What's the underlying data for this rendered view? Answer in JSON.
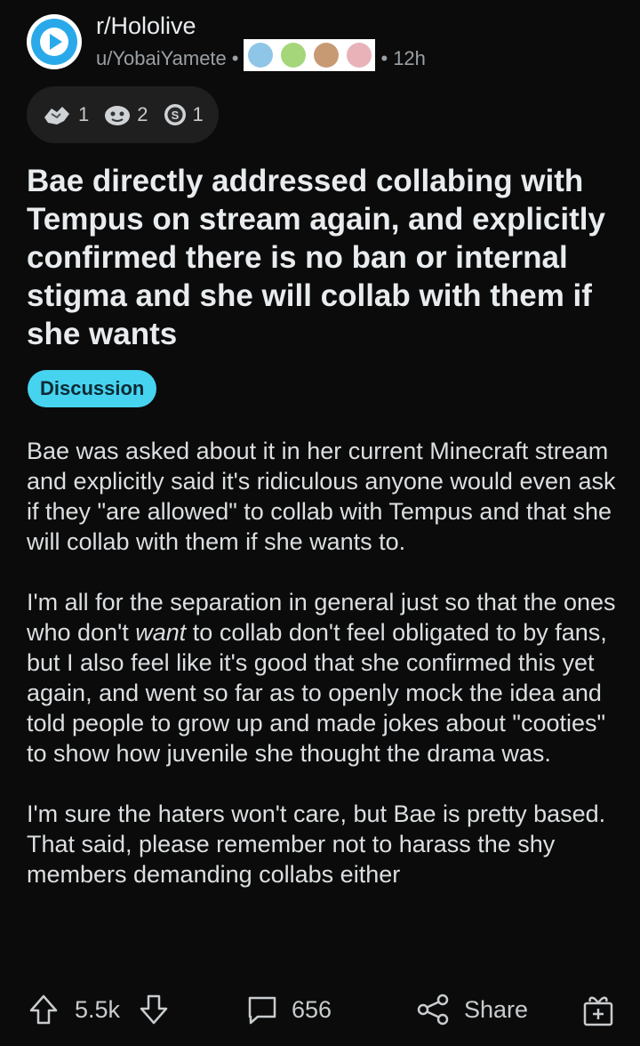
{
  "post": {
    "subreddit": "r/Hololive",
    "author": "u/YobaiYamete",
    "separator": "•",
    "age": "12h",
    "title": "Bae directly addressed collabing with Tempus on stream again, and explicitly confirmed there is no ban or internal stigma and she will collab with them if she wants",
    "flair": "Discussion",
    "awards": [
      {
        "icon": "award-handshake-icon",
        "count": "1"
      },
      {
        "icon": "award-face-icon",
        "count": "2"
      },
      {
        "icon": "award-silver-icon",
        "count": "1"
      }
    ],
    "body": {
      "p1": "Bae was asked about it in her current Minecraft stream and explicitly said it's ridiculous anyone would even ask if they \"are allowed\" to collab with Tempus and that she will collab with them if she wants to.",
      "p2_before": "I'm all for the separation in general just so that the ones who don't ",
      "p2_em": "want",
      "p2_after": " to collab don't feel obligated to by fans, but I also  feel like it's good that she confirmed this yet again, and went so far as to openly mock the idea and told people to grow up and made jokes about \"cooties\" to show how juvenile she thought the drama was.",
      "p3": "I'm sure the haters won't care, but Bae is pretty based. That said, please remember not to harass the shy members demanding collabs either"
    }
  },
  "actions": {
    "score": "5.5k",
    "comments": "656",
    "share": "Share"
  },
  "colors": {
    "background": "#0b0b0b",
    "flair_bg": "#46d3f0",
    "subreddit_icon": "#2aa9ea"
  }
}
